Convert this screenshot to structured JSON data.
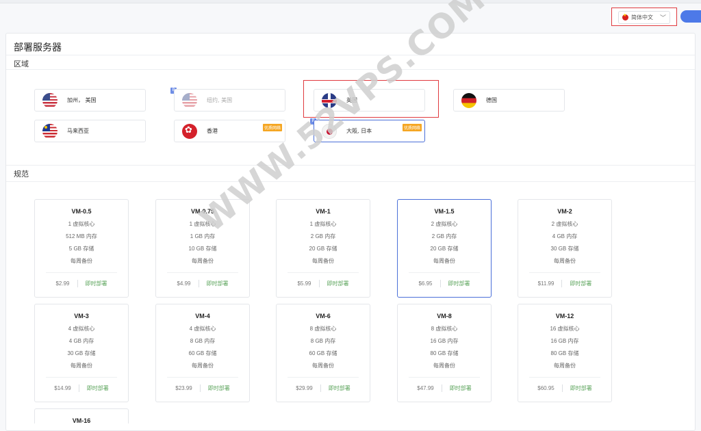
{
  "header": {
    "language_label": "简体中文",
    "language_icon": "cn-flag-icon",
    "chevron_icon": "chevron-down-icon"
  },
  "page": {
    "title": "部署服务器",
    "region_section": "区域",
    "spec_section": "规范"
  },
  "regions": [
    {
      "name": "加州， 美国",
      "flag": "us-flag-icon",
      "state": "normal",
      "badge": ""
    },
    {
      "name": "纽约, 美国",
      "flag": "us-flag-icon",
      "state": "disabled",
      "badge": "",
      "tag": "B"
    },
    {
      "name": "英国",
      "flag": "uk-flag-icon",
      "state": "normal",
      "badge": ""
    },
    {
      "name": "德国",
      "flag": "de-flag-icon",
      "state": "normal",
      "badge": ""
    },
    {
      "name": "马来西亚",
      "flag": "my-flag-icon",
      "state": "normal",
      "badge": ""
    },
    {
      "name": "香港",
      "flag": "hk-flag-icon",
      "state": "normal",
      "badge": "优质网络"
    },
    {
      "name": "大阪, 日本",
      "flag": "jp-flag-icon",
      "state": "selected",
      "badge": "优质网络",
      "tag": "B"
    }
  ],
  "plans": [
    {
      "name": "VM-0.5",
      "cpu": "1 虚拟核心",
      "ram": "512 MB 内存",
      "disk": "5 GB 存储",
      "backup": "每周备份",
      "price": "$2.99",
      "action": "即时部署"
    },
    {
      "name": "VM-0.75",
      "cpu": "1 虚拟核心",
      "ram": "1 GB 内存",
      "disk": "10 GB 存储",
      "backup": "每周备份",
      "price": "$4.99",
      "action": "即时部署"
    },
    {
      "name": "VM-1",
      "cpu": "1 虚拟核心",
      "ram": "2 GB 内存",
      "disk": "20 GB 存储",
      "backup": "每周备份",
      "price": "$5.99",
      "action": "即时部署"
    },
    {
      "name": "VM-1.5",
      "cpu": "2 虚拟核心",
      "ram": "2 GB 内存",
      "disk": "20 GB 存储",
      "backup": "每周备份",
      "price": "$6.95",
      "action": "即时部署"
    },
    {
      "name": "VM-2",
      "cpu": "2 虚拟核心",
      "ram": "4 GB 内存",
      "disk": "30 GB 存储",
      "backup": "每周备份",
      "price": "$11.99",
      "action": "即时部署"
    },
    {
      "name": "VM-3",
      "cpu": "4 虚拟核心",
      "ram": "4 GB 内存",
      "disk": "30 GB 存储",
      "backup": "每周备份",
      "price": "$14.99",
      "action": "即时部署"
    },
    {
      "name": "VM-4",
      "cpu": "4 虚拟核心",
      "ram": "8 GB 内存",
      "disk": "60 GB 存储",
      "backup": "每周备份",
      "price": "$23.99",
      "action": "即时部署"
    },
    {
      "name": "VM-6",
      "cpu": "8 虚拟核心",
      "ram": "8 GB 内存",
      "disk": "60 GB 存储",
      "backup": "每周备份",
      "price": "$29.99",
      "action": "即时部署"
    },
    {
      "name": "VM-8",
      "cpu": "8 虚拟核心",
      "ram": "16 GB 内存",
      "disk": "80 GB 存储",
      "backup": "每周备份",
      "price": "$47.99",
      "action": "即时部署"
    },
    {
      "name": "VM-12",
      "cpu": "16 虚拟核心",
      "ram": "16 GB 内存",
      "disk": "80 GB 存储",
      "backup": "每周备份",
      "price": "$60.95",
      "action": "即时部署"
    },
    {
      "name": "VM-16"
    }
  ],
  "selected_plan": "VM-1.5",
  "watermark": "WWW.52VPS.COM",
  "colors": {
    "accent": "#4a6fd8",
    "highlight": "#e0393e",
    "deploy": "#5aa35a",
    "badge": "#f5a623"
  }
}
